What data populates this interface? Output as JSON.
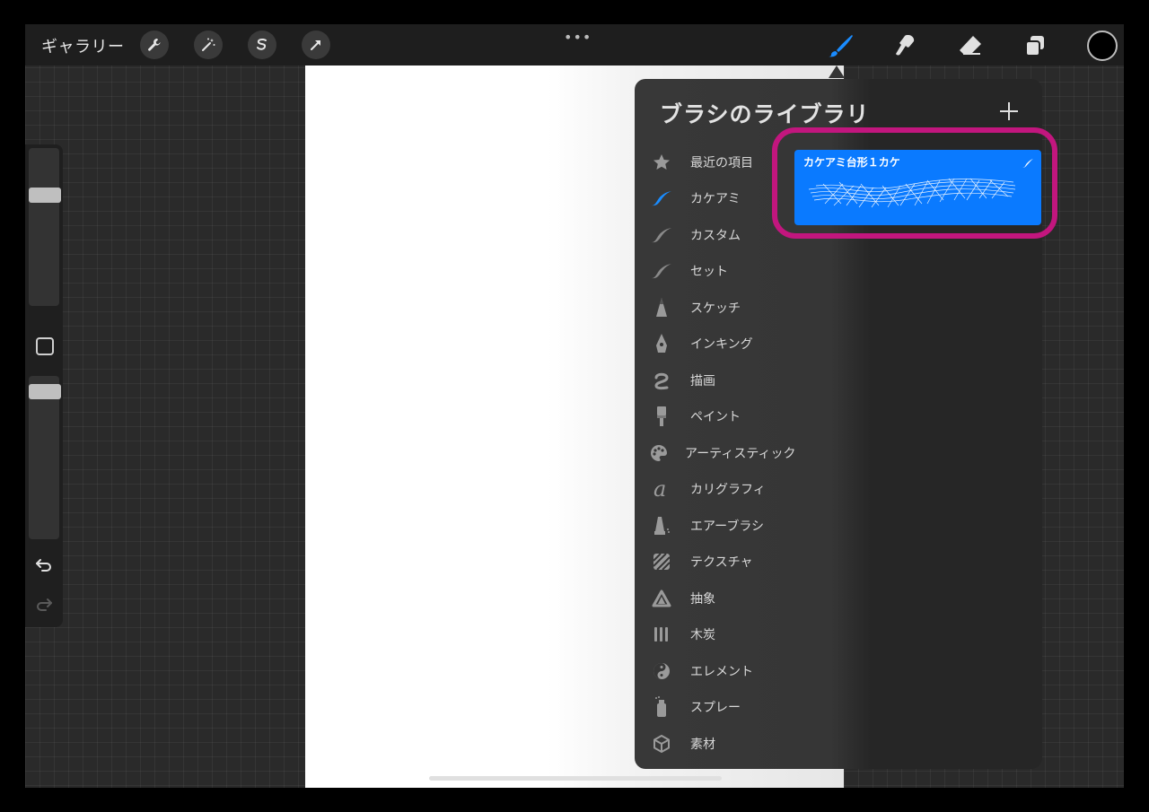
{
  "topbar": {
    "gallery_label": "ギャラリー",
    "menu_dots": "•••",
    "left_tools": [
      "wrench-icon",
      "magic-wand-icon",
      "selection-icon",
      "transform-arrow-icon"
    ],
    "right_tools": [
      "brush-icon",
      "smudge-icon",
      "eraser-icon",
      "layers-icon"
    ],
    "current_color": "#000000"
  },
  "sidebar": {
    "brush_size_level": 0.2,
    "opacity_level": 0.1,
    "buttons": [
      "modify-square-icon",
      "undo-icon",
      "redo-icon"
    ]
  },
  "brush_library": {
    "title": "ブラシのライブラリ",
    "categories": [
      {
        "label": "最近の項目",
        "icon": "star-icon",
        "selected": false
      },
      {
        "label": "カケアミ",
        "icon": "brush-stroke-icon",
        "selected": true
      },
      {
        "label": "カスタム",
        "icon": "brush-stroke-icon",
        "selected": false
      },
      {
        "label": "セット",
        "icon": "brush-stroke-icon",
        "selected": false
      },
      {
        "label": "スケッチ",
        "icon": "pencil-tip-icon",
        "selected": false
      },
      {
        "label": "インキング",
        "icon": "pen-nib-icon",
        "selected": false
      },
      {
        "label": "描画",
        "icon": "squiggle-icon",
        "selected": false
      },
      {
        "label": "ペイント",
        "icon": "paintbrush-icon",
        "selected": false
      },
      {
        "label": "アーティスティック",
        "icon": "palette-icon",
        "selected": false
      },
      {
        "label": "カリグラフィ",
        "icon": "calligraphy-a-icon",
        "selected": false
      },
      {
        "label": "エアーブラシ",
        "icon": "airbrush-icon",
        "selected": false
      },
      {
        "label": "テクスチャ",
        "icon": "texture-icon",
        "selected": false
      },
      {
        "label": "抽象",
        "icon": "triangle-icon",
        "selected": false
      },
      {
        "label": "木炭",
        "icon": "charcoal-icon",
        "selected": false
      },
      {
        "label": "エレメント",
        "icon": "yin-yang-icon",
        "selected": false
      },
      {
        "label": "スプレー",
        "icon": "spray-can-icon",
        "selected": false
      },
      {
        "label": "素材",
        "icon": "cube-icon",
        "selected": false
      }
    ],
    "brush": {
      "name": "カケアミ台形１カケ",
      "selected": true
    }
  },
  "colors": {
    "accent_blue": "#0a7aff",
    "highlight_magenta": "#c2167e",
    "panel_bg": "#363636"
  }
}
